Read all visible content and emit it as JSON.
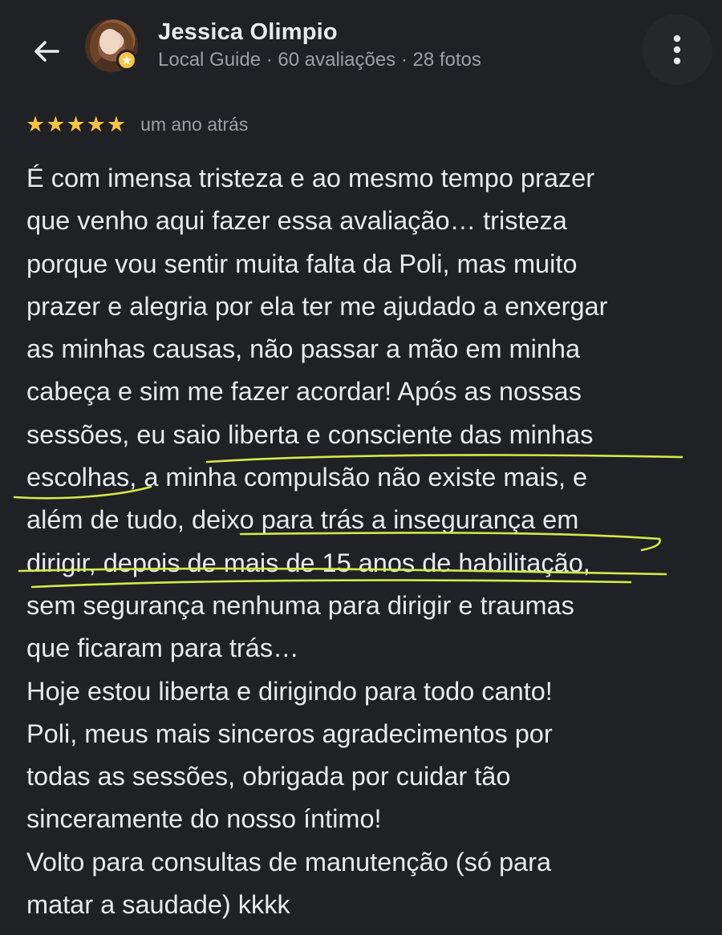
{
  "header": {
    "back_icon": "arrow-left-icon",
    "reviewer_name": "Jessica Olimpio",
    "subtitle": "Local Guide · 60 avaliações · 28 fotos",
    "more_icon": "more-vertical-icon"
  },
  "rating": {
    "stars": 5,
    "max_stars": 5,
    "star_color": "#F6C344",
    "time_ago": "um ano atrás"
  },
  "review": {
    "lines": [
      "É com imensa tristeza e ao mesmo tempo prazer",
      "que venho aqui fazer essa avaliação… tristeza",
      "porque vou sentir muita falta da Poli, mas muito",
      "prazer e alegria por ela ter me ajudado a enxergar",
      "as minhas causas, não passar a mão em minha",
      "cabeça e sim me fazer acordar! Após as nossas",
      "sessões, eu saio liberta e consciente das minhas",
      "escolhas, a minha compulsão não existe mais, e",
      "além de tudo, deixo para trás a insegurança em",
      "dirigir, depois de mais de 15 anos de habilitação,",
      "sem segurança nenhuma para dirigir e traumas",
      "que ficaram para trás…",
      "Hoje estou liberta e dirigindo para todo canto!",
      "Poli, meus mais sinceros agradecimentos por",
      "todas as sessões, obrigada por cuidar tão",
      "sinceramente do nosso íntimo!",
      "Volto para consultas de manutenção (só para",
      "matar a saudade) kkkk"
    ]
  },
  "colors": {
    "background": "#202124",
    "text_primary": "#E8EAED",
    "text_secondary": "#9AA0A6",
    "highlight_underline": "#D4E84A"
  }
}
